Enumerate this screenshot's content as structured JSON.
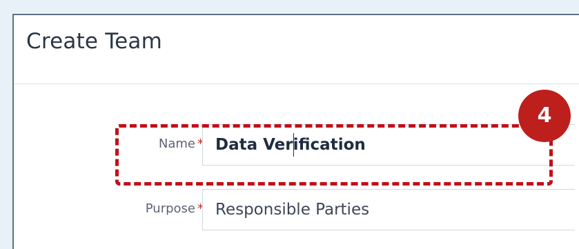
{
  "dialog": {
    "title": "Create Team"
  },
  "form": {
    "name": {
      "label": "Name",
      "required_mark": "*",
      "value": "Data Verification"
    },
    "purpose": {
      "label": "Purpose",
      "required_mark": "*",
      "value": "Responsible Parties"
    }
  },
  "annotation": {
    "step_number": "4"
  },
  "colors": {
    "background": "#e9f1f8",
    "annotation_red": "#bd1f1d",
    "required_star": "#c62828"
  }
}
